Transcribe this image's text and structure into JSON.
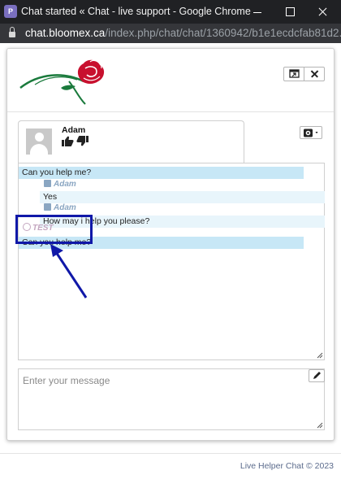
{
  "browser": {
    "app_icon": "profile-icon",
    "title": "Chat started « Chat - live support - Google Chrome",
    "url_host": "chat.bloomex.ca",
    "url_path": "/index.php/chat/chat/1360942/b1e1ecdcfab81d2..."
  },
  "operator": {
    "name": "Adam"
  },
  "messages": {
    "visitor_1": "Can you help me?",
    "operator_label": "Adam",
    "operator_1": "Yes",
    "operator_2": "How may i help you please?",
    "system_label": "TEST",
    "visitor_2": "Can you help me?"
  },
  "composer": {
    "placeholder": "Enter your message"
  },
  "footer": {
    "text": "Live Helper Chat © 2023"
  },
  "colors": {
    "visitor_bg": "#c7e7f6",
    "operator_bg": "#e8f5fb",
    "annotation": "#1018a8",
    "logo_rose": "#c8102e",
    "logo_stem": "#1a7a3c"
  },
  "icons": [
    "lock-icon",
    "expand-icon",
    "close-icon",
    "settings-icon",
    "thumbs-up-icon",
    "thumbs-down-icon",
    "user-icon",
    "pencil-icon"
  ]
}
